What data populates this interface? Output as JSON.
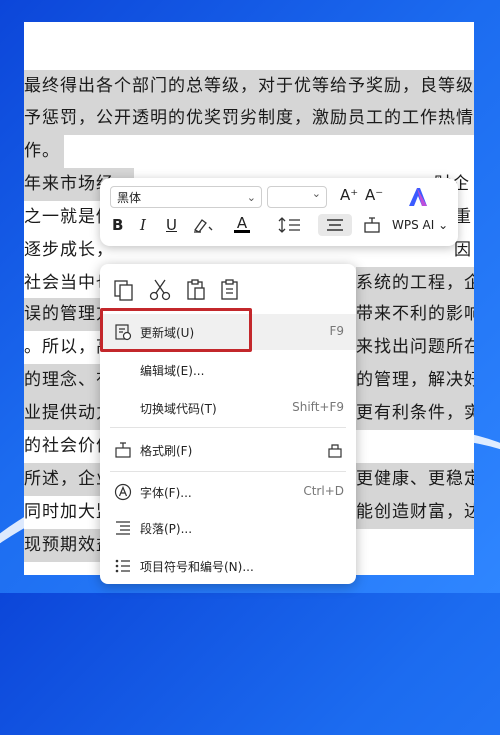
{
  "document": {
    "lines": [
      "最终得出各个部门的总等级，对于优等给予奖励，良等级给予鼓",
      "予惩罚，公开透明的优奖罚劣制度，激励员工的工作热情，做好",
      "作。",
      "年来市场经",
      "之一就是做",
      "逐步成长，",
      "社会当中也",
      "误的管理方",
      "。所以，高",
      "的理念、有",
      "业提供动力",
      "的社会价值",
      "所述，企业",
      "同时加大监",
      "现预期效益"
    ],
    "right_fragments": [
      "",
      "",
      "",
      "财企",
      "重",
      "因",
      "，企",
      "影响",
      "问题所在",
      "决好自",
      "，实",
      "",
      "",
      "，达",
      ""
    ]
  },
  "toolbar": {
    "font_name": "黑体",
    "font_size": "",
    "increase_font": "A⁺",
    "decrease_font": "A⁻",
    "bold": "B",
    "italic": "I",
    "underline": "U",
    "font_color": "A",
    "wps_ai": "WPS AI",
    "accent": "#3b5bff"
  },
  "menu": {
    "items": [
      {
        "label": "更新域(U)",
        "shortcut": "F9"
      },
      {
        "label": "编辑域(E)...",
        "shortcut": ""
      },
      {
        "label": "切换域代码(T)",
        "shortcut": "Shift+F9"
      },
      {
        "label": "格式刷(F)",
        "shortcut": ""
      },
      {
        "label": "字体(F)...",
        "shortcut": "Ctrl+D"
      },
      {
        "label": "段落(P)...",
        "shortcut": ""
      },
      {
        "label": "项目符号和编号(N)...",
        "shortcut": ""
      }
    ],
    "behind_texts": [
      "系统的工程，企",
      "带来不利的影响",
      "来找出问题所在",
      "的管理，解决好自",
      "更有利条件，实",
      "更健康、更稳定、",
      "能创造财富，达"
    ]
  },
  "colors": {
    "highlight_box": "#c3272b",
    "selection": "#d6d6d6"
  }
}
